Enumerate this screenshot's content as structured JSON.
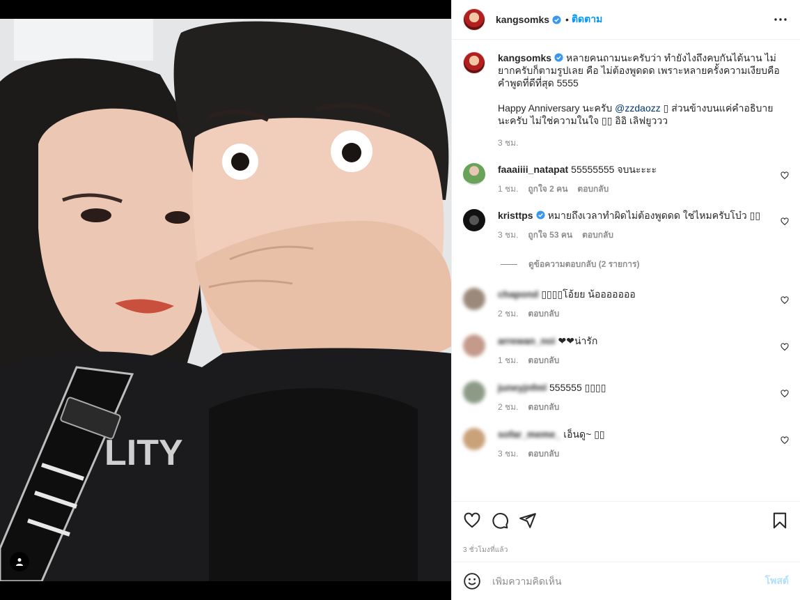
{
  "post": {
    "username": "kangsomks",
    "follow_label": "ติดตาม",
    "caption_part1": "หลายคนถามนะครับว่า ทำยังไงถึงคบกันได้นาน ไม่ยากครับก็ตามรูปเลย คือ ไม่ต้องพูดดด เพราะหลายครั้งความเงียบคือคำพูดที่ดีที่สุด 5555",
    "caption_part2_prefix": "Happy Anniversary นะครับ ",
    "caption_mention": "@zzdaozz",
    "caption_part2_suffix": " ▯ ส่วนข้างบนแค่คำอธิบายนะครับ ไม่ใช่ความในใจ ▯▯ อิอิ เลิฟยูววว",
    "caption_time": "3 ชม.",
    "posted_ago": "3 ชั่วโมงที่แล้ว",
    "accent_color": "#0095f6"
  },
  "comments": [
    {
      "username": "faaaiiii_natapat",
      "text": "55555555 จบนะะะะ",
      "time": "1 ชม.",
      "likes": "ถูกใจ 2 คน",
      "reply": "ตอบกลับ",
      "verified": false
    },
    {
      "username": "kristtps",
      "text": "หมายถึงเวลาทำผิดไม่ต้องพูดดด ใช่ไหมครับโบ๋ว ▯▯",
      "time": "3 ชม.",
      "likes": "ถูกใจ 53 คน",
      "reply": "ตอบกลับ",
      "verified": true
    }
  ],
  "view_replies_label": "ดูข้อความตอบกลับ (2 รายการ)",
  "replies": [
    {
      "username": "chapond",
      "text": "▯▯▯▯โอ้ยย น้อออออออ",
      "time": "2 ชม.",
      "reply": "ตอบกลับ"
    },
    {
      "username": "arrewan_noi",
      "text": "❤❤น่ารัก",
      "time": "1 ชม.",
      "reply": "ตอบกลับ"
    },
    {
      "username": "juneyjnfml",
      "text": "555555 ▯▯▯▯",
      "time": "2 ชม.",
      "reply": "ตอบกลับ"
    },
    {
      "username": "sofar_meme_",
      "text": "เอ็นดู~ ▯▯",
      "time": "3 ชม.",
      "reply": "ตอบกลับ"
    }
  ],
  "add_comment": {
    "placeholder": "เพิ่มความคิดเห็น",
    "post_label": "โพสต์"
  },
  "photo_text": {
    "shirt": "LITY"
  }
}
